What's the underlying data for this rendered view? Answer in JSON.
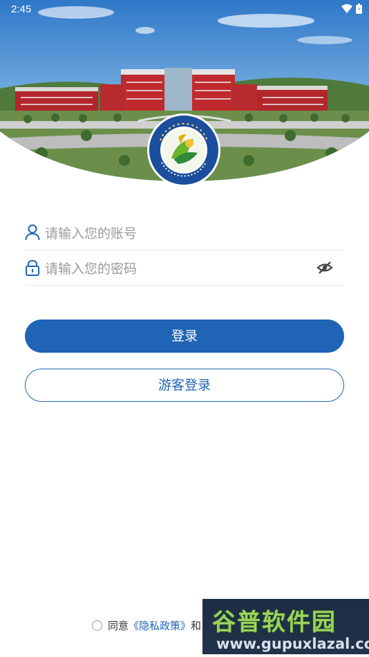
{
  "status_bar": {
    "time": "2:45"
  },
  "login": {
    "account_placeholder": "请输入您的账号",
    "password_placeholder": "请输入您的密码",
    "login_button": "登录",
    "guest_button": "游客登录"
  },
  "agreement": {
    "prefix": "同意",
    "privacy_link": "《隐私政策》",
    "suffix": "和"
  },
  "watermark": {
    "title": "谷普软件园",
    "url": "www.gupuxlazal.com"
  },
  "colors": {
    "accent": "#1f64b5",
    "placeholder": "#9a9a9a",
    "divider": "#e6e6e6"
  },
  "icons": {
    "account": "user-icon",
    "password": "lock-icon",
    "toggle_visibility": "eye-off-icon",
    "logo": "school-logo"
  }
}
